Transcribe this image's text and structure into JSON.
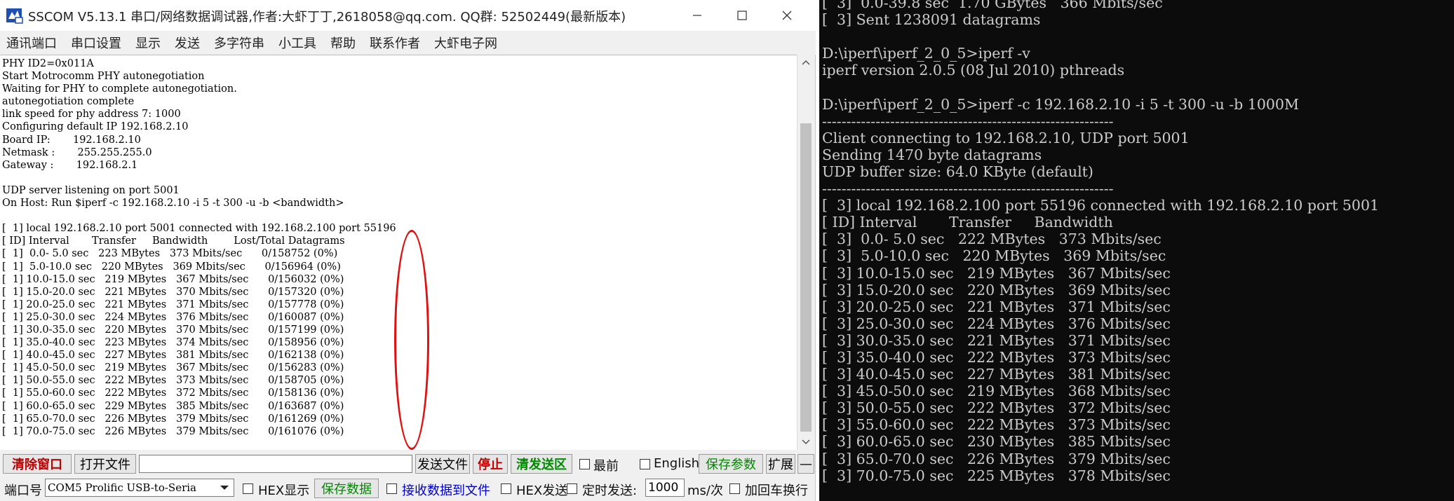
{
  "window": {
    "title": "SSCOM V5.13.1 串口/网络数据调试器,作者:大虾丁丁,2618058@qq.com. QQ群: 52502449(最新版本)",
    "icons": [
      "app-icon",
      "minimize-icon",
      "maximize-icon",
      "close-icon"
    ]
  },
  "menu": [
    "通讯端口",
    "串口设置",
    "显示",
    "发送",
    "多字符串",
    "小工具",
    "帮助",
    "联系作者",
    "大虾电子网"
  ],
  "log": "PHY ID2=0x011A\nStart Motrocomm PHY autonegotiation\nWaiting for PHY to complete autonegotiation.\nautonegotiation complete\nlink speed for phy address 7: 1000\nConfiguring default IP 192.168.2.10\nBoard IP:       192.168.2.10\nNetmask :       255.255.255.0\nGateway :       192.168.2.1\n\nUDP server listening on port 5001\nOn Host: Run $iperf -c 192.168.2.10 -i 5 -t 300 -u -b <bandwidth>\n\n[  1] local 192.168.2.10 port 5001 connected with 192.168.2.100 port 55196\n[ ID] Interval       Transfer     Bandwidth        Lost/Total Datagrams\n[  1]  0.0- 5.0 sec   223 MBytes   373 Mbits/sec      0/158752 (0%)\n[  1]  5.0-10.0 sec   220 MBytes   369 Mbits/sec      0/156964 (0%)\n[  1] 10.0-15.0 sec   219 MBytes   367 Mbits/sec      0/156032 (0%)\n[  1] 15.0-20.0 sec   221 MBytes   370 Mbits/sec      0/157320 (0%)\n[  1] 20.0-25.0 sec   221 MBytes   371 Mbits/sec      0/157778 (0%)\n[  1] 25.0-30.0 sec   224 MBytes   376 Mbits/sec      0/160087 (0%)\n[  1] 30.0-35.0 sec   220 MBytes   370 Mbits/sec      0/157199 (0%)\n[  1] 35.0-40.0 sec   223 MBytes   374 Mbits/sec      0/158956 (0%)\n[  1] 40.0-45.0 sec   227 MBytes   381 Mbits/sec      0/162138 (0%)\n[  1] 45.0-50.0 sec   219 MBytes   367 Mbits/sec      0/156283 (0%)\n[  1] 50.0-55.0 sec   222 MBytes   373 Mbits/sec      0/158705 (0%)\n[  1] 55.0-60.0 sec   222 MBytes   372 Mbits/sec      0/158136 (0%)\n[  1] 60.0-65.0 sec   229 MBytes   385 Mbits/sec      0/163687 (0%)\n[  1] 65.0-70.0 sec   226 MBytes   379 Mbits/sec      0/161269 (0%)\n[  1] 70.0-75.0 sec   226 MBytes   379 Mbits/sec      0/161076 (0%)",
  "send_row": {
    "clear_window": "清除窗口",
    "open_file": "打开文件",
    "send_file": "发送文件",
    "stop": "停止",
    "clear_send_area": "清发送区",
    "topmost": "最前",
    "english": "English",
    "save_params": "保存参数",
    "expand": "扩展",
    "collapse": "—"
  },
  "port_row": {
    "port_label": "端口号",
    "port_value": "COM5 Prolific USB-to-Seria",
    "hex_display": "HEX显示",
    "save_data": "保存数据",
    "receive_to_file": "接收数据到文件",
    "hex_send": "HEX发送",
    "timed_send": "定时发送:",
    "interval_value": "1000",
    "interval_unit": "ms/次",
    "append_crlf": "加回车换行"
  },
  "console": "[  3]  0.0-39.8 sec  1.70 GBytes   366 Mbits/sec\n[  3] Sent 1238091 datagrams\n\nD:\\iperf\\iperf_2_0_5>iperf -v\niperf version 2.0.5 (08 Jul 2010) pthreads\n\nD:\\iperf\\iperf_2_0_5>iperf -c 192.168.2.10 -i 5 -t 300 -u -b 1000M\n------------------------------------------------------------\nClient connecting to 192.168.2.10, UDP port 5001\nSending 1470 byte datagrams\nUDP buffer size: 64.0 KByte (default)\n------------------------------------------------------------\n[  3] local 192.168.2.100 port 55196 connected with 192.168.2.10 port 5001\n[ ID] Interval       Transfer     Bandwidth\n[  3]  0.0- 5.0 sec   222 MBytes   373 Mbits/sec\n[  3]  5.0-10.0 sec   220 MBytes   369 Mbits/sec\n[  3] 10.0-15.0 sec   219 MBytes   367 Mbits/sec\n[  3] 15.0-20.0 sec   220 MBytes   369 Mbits/sec\n[  3] 20.0-25.0 sec   221 MBytes   371 Mbits/sec\n[  3] 25.0-30.0 sec   224 MBytes   376 Mbits/sec\n[  3] 30.0-35.0 sec   221 MBytes   371 Mbits/sec\n[  3] 35.0-40.0 sec   222 MBytes   373 Mbits/sec\n[  3] 40.0-45.0 sec   227 MBytes   381 Mbits/sec\n[  3] 45.0-50.0 sec   219 MBytes   368 Mbits/sec\n[  3] 50.0-55.0 sec   222 MBytes   372 Mbits/sec\n[  3] 55.0-60.0 sec   222 MBytes   373 Mbits/sec\n[  3] 60.0-65.0 sec   230 MBytes   385 Mbits/sec\n[  3] 65.0-70.0 sec   226 MBytes   379 Mbits/sec\n[  3] 70.0-75.0 sec   225 MBytes   378 Mbits/sec",
  "colors": {
    "highlight": "#e01010",
    "button_red": "#c00000",
    "button_green": "#008a00",
    "console_bg": "#0c0c0c",
    "console_fg": "#cccccc"
  }
}
